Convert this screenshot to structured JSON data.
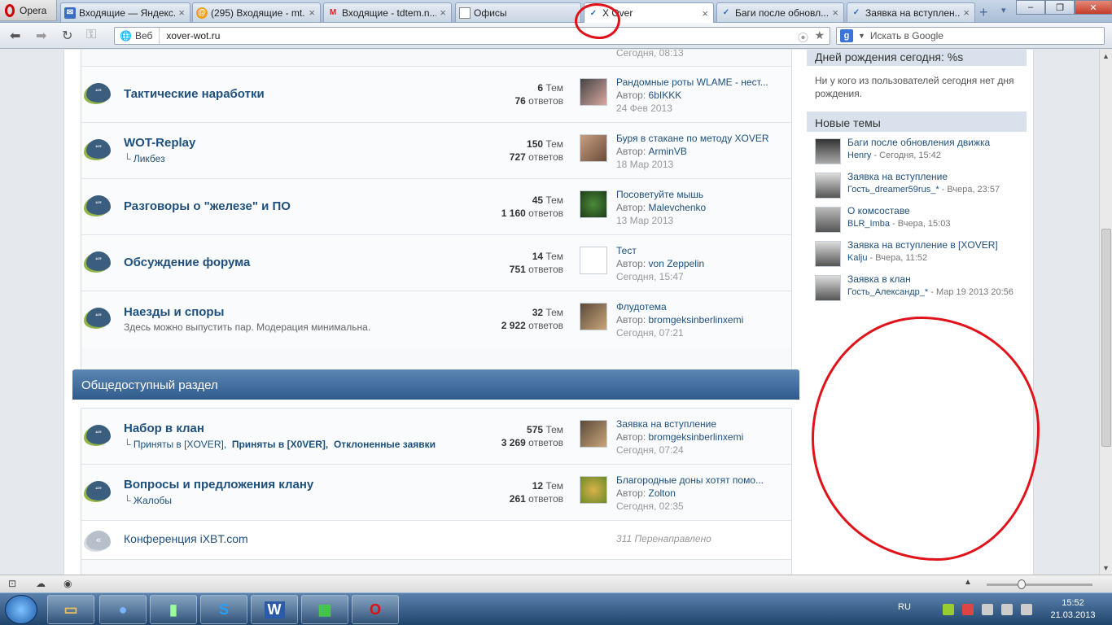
{
  "browser": {
    "menu_label": "Opera",
    "tabs": [
      {
        "title": "Входящие — Яндекс...",
        "icon": "mail-icon"
      },
      {
        "title": "(295) Входящие - mt...",
        "icon": "at-icon"
      },
      {
        "title": "Входящие - tdtem.n...",
        "icon": "gmail-icon"
      },
      {
        "title": "Офисы",
        "icon": "document-icon"
      },
      {
        "title": "X Over",
        "icon": "xover-icon"
      },
      {
        "title": "Баги после обновл...",
        "icon": "xover-icon"
      },
      {
        "title": "Заявка на вступлен...",
        "icon": "xover-icon"
      }
    ],
    "address_mode": "Веб",
    "url": "xover-wot.ru",
    "search_placeholder": "Искать в Google"
  },
  "forum": {
    "top_cropped_date": "Сегодня, 08:13",
    "nodes": [
      {
        "name": "Тактические наработки",
        "sub": "",
        "threads": "6",
        "threads_label": "Тем",
        "posts": "76",
        "posts_label": "ответов",
        "last_title": "Рандомные роты WLAME - нест...",
        "last_author_label": "Автор:",
        "last_author": "6bIKKK",
        "last_date": "24 Фев 2013"
      },
      {
        "name": "WOT-Replay",
        "sub": "Ликбез",
        "threads": "150",
        "threads_label": "Тем",
        "posts": "727",
        "posts_label": "ответов",
        "last_title": "Буря в стакане по методу XOVER",
        "last_author_label": "Автор:",
        "last_author": "ArminVB",
        "last_date": "18 Мар 2013"
      },
      {
        "name": "Разговоры о \"железе\" и ПО",
        "sub": "",
        "threads": "45",
        "threads_label": "Тем",
        "posts": "1 160",
        "posts_label": "ответов",
        "last_title": "Посоветуйте мышь",
        "last_author_label": "Автор:",
        "last_author": "Malevchenko",
        "last_date": "13 Мар 2013"
      },
      {
        "name": "Обсуждение форума",
        "sub": "",
        "threads": "14",
        "threads_label": "Тем",
        "posts": "751",
        "posts_label": "ответов",
        "last_title": "Тест",
        "last_author_label": "Автор:",
        "last_author": "von Zeppelin",
        "last_date": "Сегодня, 15:47"
      },
      {
        "name": "Наезды и споры",
        "sub": "Здесь можно выпустить пар. Модерация минимальна.",
        "threads": "32",
        "threads_label": "Тем",
        "posts": "2 922",
        "posts_label": "ответов",
        "last_title": "Флудотема",
        "last_author_label": "Автор:",
        "last_author": "bromgeksinberlinxemi",
        "last_date": "Сегодня, 07:21"
      }
    ],
    "section_title": "Общедоступный раздел",
    "section_nodes": [
      {
        "name": "Набор в клан",
        "sub_links": [
          "Приняты в [XOVER],",
          "Приняты в [X0VER],",
          "Отклоненные заявки"
        ],
        "threads": "575",
        "threads_label": "Тем",
        "posts": "3 269",
        "posts_label": "ответов",
        "last_title": "Заявка на вступление",
        "last_author_label": "Автор:",
        "last_author": "bromgeksinberlinxemi",
        "last_date": "Сегодня, 07:24"
      },
      {
        "name": "Вопросы и предложения клану",
        "sub_links": [
          "Жалобы"
        ],
        "threads": "12",
        "threads_label": "Тем",
        "posts": "261",
        "posts_label": "ответов",
        "last_title": "Благородные доны хотят помо...",
        "last_author_label": "Автор:",
        "last_author": "Zolton",
        "last_date": "Сегодня, 02:35"
      }
    ],
    "redirect_node": {
      "name": "Конференция iXBT.com",
      "note": "311 Перенаправлено"
    }
  },
  "sidebar": {
    "birthdays_title": "Дней рождения сегодня: %s",
    "birthdays_text": "Ни у кого из пользователей сегодня нет дня рождения.",
    "new_threads_title": "Новые темы",
    "threads": [
      {
        "title": "Баги после обновления движка",
        "author": "Henry",
        "time": "- Сегодня, 15:42"
      },
      {
        "title": "Заявка на вступление",
        "author": "Гость_dreamer59rus_*",
        "time": "- Вчера, 23:57"
      },
      {
        "title": "О комсоставе",
        "author": "BLR_Imba",
        "time": "- Вчера, 15:03"
      },
      {
        "title": "Заявка на вступление в [XOVER]",
        "author": "Kalju",
        "time": "- Вчера, 11:52"
      },
      {
        "title": "Заявка в клан",
        "author": "Гость_Александр_*",
        "time": "- Мар 19 2013 20:56"
      }
    ]
  },
  "taskbar": {
    "lang": "RU",
    "time": "15:52",
    "date": "21.03.2013"
  },
  "colors": {
    "accent": "#1e4f7d",
    "section_header": "#2f5b8c",
    "annotation": "#e0121a"
  }
}
